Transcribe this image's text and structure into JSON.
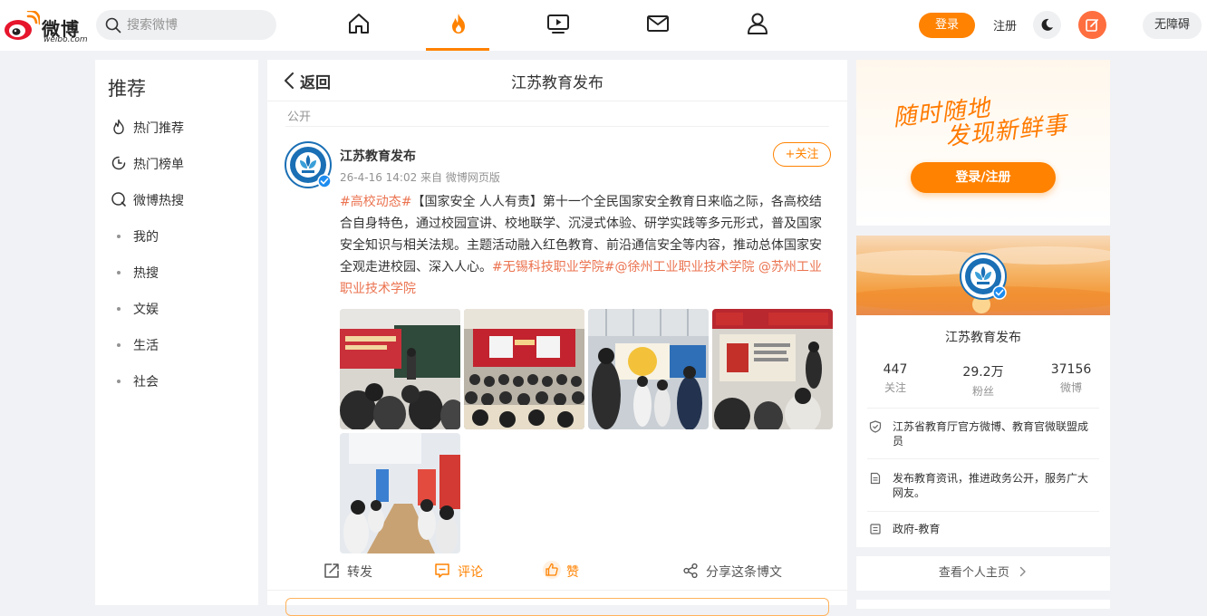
{
  "header": {
    "logo_text": "微博",
    "logo_sub": "weibo.com",
    "search_placeholder": "搜索微博",
    "nav": [
      "home-icon",
      "hot-icon",
      "video-icon",
      "mail-icon",
      "profile-icon"
    ],
    "login_label": "登录",
    "register_label": "注册",
    "accessibility_label": "无障碍"
  },
  "sidebar": {
    "title": "推荐",
    "items": [
      {
        "label": "热门推荐",
        "icon": "fire-icon"
      },
      {
        "label": "热门榜单",
        "icon": "clock-icon"
      },
      {
        "label": "微博热搜",
        "icon": "search-circle-icon"
      },
      {
        "label": "我的",
        "icon": "dot"
      },
      {
        "label": "热搜",
        "icon": "dot"
      },
      {
        "label": "文娱",
        "icon": "dot"
      },
      {
        "label": "生活",
        "icon": "dot"
      },
      {
        "label": "社会",
        "icon": "dot"
      }
    ]
  },
  "main": {
    "back_label": "返回",
    "title": "江苏教育发布",
    "visibility": "公开",
    "post": {
      "author": "江苏教育发布",
      "meta": "26-4-16 14:02 来自 微博网页版",
      "follow_label": "+关注",
      "text_segments": [
        {
          "text": "#高校动态#",
          "tag": true
        },
        {
          "text": "【国家安全 人人有责】第十一个全民国家安全教育日来临之际，各高校结合自身特色，通过校园宣讲、校地联学、沉浸式体验、研学实践等多元形式，普及国家安全知识与相关法规。主题活动融入红色教育、前沿通信安全等内容，推动总体国家安全观走进校园、深入人心。",
          "tag": false
        },
        {
          "text": "#无锡科技职业学院#",
          "tag": true
        },
        {
          "text": "@徐州工业职业技术学院",
          "tag": true
        },
        {
          "text": " ",
          "tag": false
        },
        {
          "text": "@苏州工业职业技术学院",
          "tag": true
        }
      ],
      "photo_count": 5,
      "actions": {
        "repost": "转发",
        "comment": "评论",
        "like": "赞",
        "share": "分享这条博文"
      }
    }
  },
  "promo": {
    "slogan_line1": "随时随地",
    "slogan_line2": "发现新鲜事",
    "button_label": "登录/注册"
  },
  "profile": {
    "name": "江苏教育发布",
    "stats": [
      {
        "value": "447",
        "label": "关注"
      },
      {
        "value": "29.2万",
        "label": "粉丝"
      },
      {
        "value": "37156",
        "label": "微博"
      }
    ],
    "info": [
      {
        "icon": "shield-icon",
        "text": "江苏省教育厅官方微博、教育官微联盟成员"
      },
      {
        "icon": "document-icon",
        "text": "发布教育资讯，推进政务公开，服务广大网友。"
      },
      {
        "icon": "category-icon",
        "text": "政府-教育"
      }
    ],
    "homepage_label": "查看个人主页"
  },
  "colors": {
    "accent": "#ff8200",
    "tag": "#eb7350",
    "background": "#f1f2f5"
  }
}
